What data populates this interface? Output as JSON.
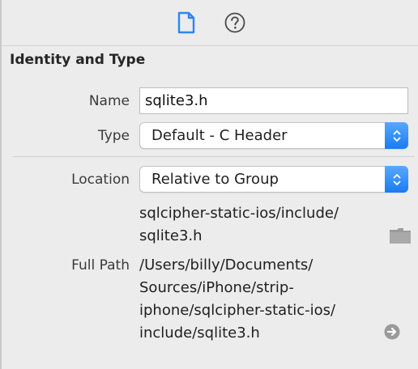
{
  "toolbar": {
    "tabs": [
      {
        "icon": "file-inspector-icon",
        "active": true
      },
      {
        "icon": "quick-help-icon",
        "active": false
      }
    ],
    "accent_color": "#2b86f7"
  },
  "identity_section": {
    "title": "Identity and Type",
    "name_label": "Name",
    "name_value": "sqlite3.h",
    "type_label": "Type",
    "type_value": "Default - C Header",
    "location_label": "Location",
    "location_value": "Relative to Group",
    "location_path_lines": [
      "sqlcipher-static-ios/include/",
      "sqlite3.h"
    ],
    "full_path_label": "Full Path",
    "full_path_lines": [
      "/Users/billy/Documents/",
      "Sources/iPhone/strip-",
      "iphone/sqlcipher-static-ios/",
      "include/sqlite3.h"
    ]
  }
}
